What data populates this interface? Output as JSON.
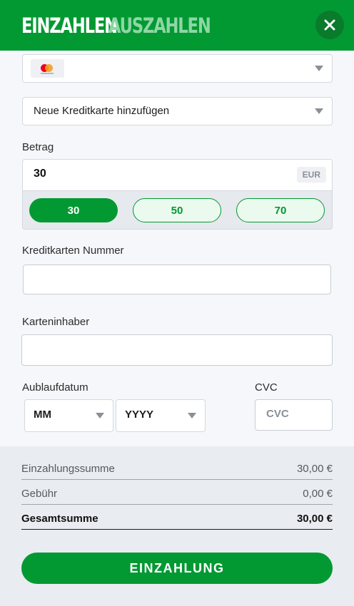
{
  "header": {
    "tab_deposit": "EINZAHLEN",
    "tab_withdraw": "AUSZAHLEN"
  },
  "payment_method": {
    "icon": "mastercard-icon"
  },
  "card_select": {
    "value": "Neue Kreditkarte hinzufügen"
  },
  "amount": {
    "label": "Betrag",
    "value": "30",
    "currency": "EUR",
    "presets": [
      "30",
      "50",
      "70"
    ],
    "selected": "30"
  },
  "card_number": {
    "label": "Kreditkarten Nummer",
    "value": ""
  },
  "card_holder": {
    "label": "Karteninhaber",
    "value": ""
  },
  "expiry": {
    "label": "Aublaufdatum",
    "month": "MM",
    "year": "YYYY"
  },
  "cvc": {
    "label": "CVC",
    "placeholder": "CVC"
  },
  "summary": {
    "rows": [
      {
        "label": "Einzahlungssumme",
        "value": "30,00 €"
      },
      {
        "label": "Gebühr",
        "value": "0,00 €"
      },
      {
        "label": "Gesamtsumme",
        "value": "30,00 €"
      }
    ]
  },
  "submit": {
    "label": "EINZAHLUNG"
  },
  "colors": {
    "brand_green": "#029932",
    "inactive_tab": "#8fd6a6"
  }
}
